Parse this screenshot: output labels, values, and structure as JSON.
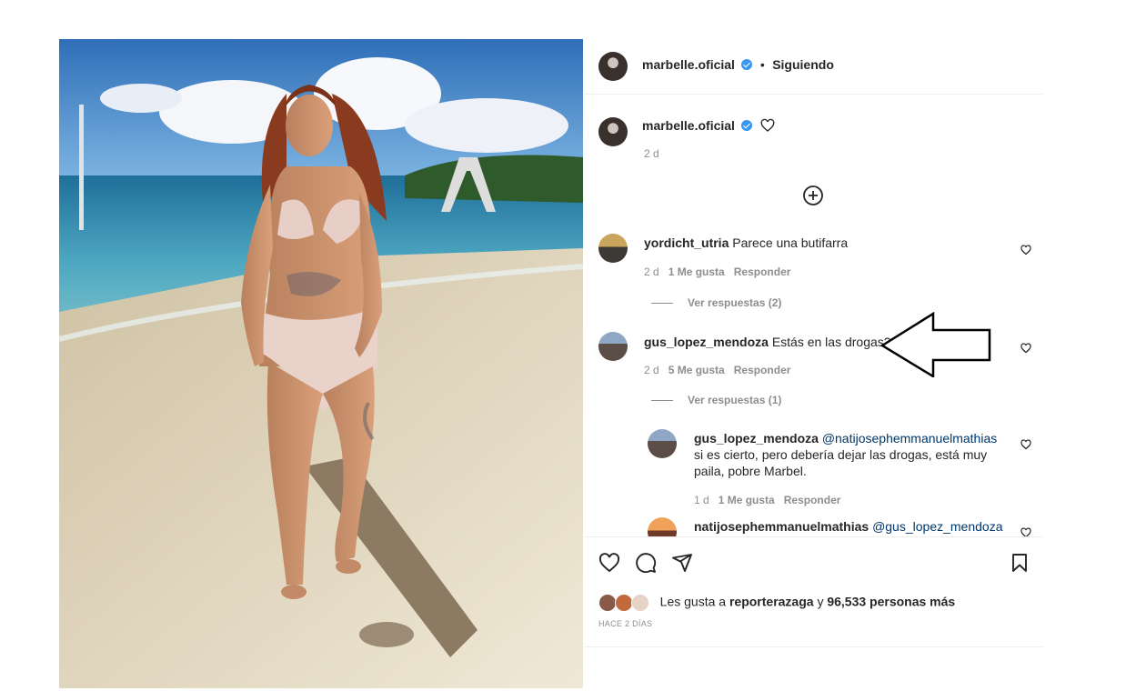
{
  "header": {
    "username": "marbelle.oficial",
    "separator": "•",
    "follow_status": "Siguiendo"
  },
  "caption": {
    "username": "marbelle.oficial",
    "time": "2 d"
  },
  "comments": [
    {
      "username": "yordicht_utria",
      "text": "Parece una butifarra",
      "time": "2 d",
      "likes": "1 Me gusta",
      "reply": "Responder",
      "view_replies": "Ver respuestas (2)"
    },
    {
      "username": "gus_lopez_mendoza",
      "text": "Estás en las drogas?",
      "time": "2 d",
      "likes": "5 Me gusta",
      "reply": "Responder",
      "view_replies": "Ver respuestas (1)"
    }
  ],
  "replies": [
    {
      "username": "gus_lopez_mendoza",
      "mention": "@natijosephemmanuelmathias",
      "text": "si es cierto, pero debería dejar las drogas, está muy paila, pobre Marbel.",
      "time": "1 d",
      "likes": "1 Me gusta",
      "reply": "Responder"
    },
    {
      "username": "natijosephemmanuelmathias",
      "mention": "@gus_lopez_mendoza"
    }
  ],
  "likes": {
    "prefix": "Les gusta a",
    "user": "reporterazaga",
    "joiner": "y",
    "others": "96,533 personas más"
  },
  "posted": "HACE 2 DÍAS",
  "icons": [
    "heart-icon",
    "comment-icon",
    "share-icon",
    "bookmark-icon",
    "add-circle-icon",
    "verified-icon"
  ],
  "colors": {
    "verified": "#3897f0",
    "mention": "#00376b",
    "meta": "#8e8e8e"
  }
}
